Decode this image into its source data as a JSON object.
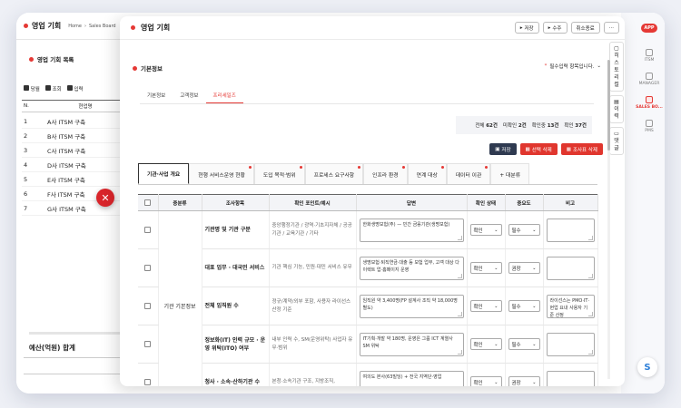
{
  "background_window": {
    "title": "영업 기회",
    "crumbs": [
      "Home",
      "Sales Board"
    ],
    "list_title": "영업 기회 목록",
    "filters": [
      "당월",
      "조회",
      "입력"
    ],
    "columns": [
      "N.",
      "현업명"
    ],
    "rows": [
      {
        "n": "1",
        "name": "A사 ITSM 구축"
      },
      {
        "n": "2",
        "name": "B사 ITSM 구축"
      },
      {
        "n": "3",
        "name": "C사 ITSM 구축"
      },
      {
        "n": "4",
        "name": "D사 ITSM 구축"
      },
      {
        "n": "5",
        "name": "E사 ITSM 구축"
      },
      {
        "n": "6",
        "name": "F사 ITSM 구축"
      },
      {
        "n": "7",
        "name": "G사 ITSM 구축"
      }
    ],
    "total_label": "예산(억원) 합계"
  },
  "rail": {
    "app_badge": "APP",
    "items": [
      {
        "label": "ITSM",
        "active": false
      },
      {
        "label": "MANAGER",
        "active": false
      },
      {
        "label": "SALES BO...",
        "active": true
      },
      {
        "label": "PMS",
        "active": false
      }
    ]
  },
  "window": {
    "title": "영업 기회",
    "buttons": [
      "저장",
      "수주",
      "취소종료",
      "···"
    ],
    "side_tabs": [
      [
        "히",
        "스",
        "토",
        "리",
        "컬"
      ],
      [
        "이",
        "력"
      ],
      [
        "댓",
        "글"
      ]
    ],
    "section_title": "기본정보",
    "required_note": "필수입력 항목입니다.",
    "tabs": [
      {
        "label": "기본정보",
        "active": false
      },
      {
        "label": "고객정보",
        "active": false
      },
      {
        "label": "프리세일즈",
        "active": true
      }
    ],
    "summary": [
      {
        "label": "전체",
        "value": "62건"
      },
      {
        "label": "미확인",
        "value": "2건"
      },
      {
        "label": "확인중",
        "value": "13건"
      },
      {
        "label": "확인",
        "value": "37건"
      }
    ],
    "actions": {
      "save": "저장",
      "delete_selected": "선택 삭제",
      "delete_search": "조사표 삭제"
    },
    "sub_tabs": [
      {
        "label": "기관·사업 개요",
        "active": true
      },
      {
        "label": "현행 서비스운영 현황",
        "active": false
      },
      {
        "label": "도입 목적·범위",
        "active": false
      },
      {
        "label": "프로세스 요구사항",
        "active": false
      },
      {
        "label": "인프라 환경",
        "active": false
      },
      {
        "label": "연계 대상",
        "active": false
      },
      {
        "label": "데이터 이관",
        "active": false
      },
      {
        "label": "+ 대분류",
        "active": false
      }
    ],
    "table": {
      "headers": [
        "",
        "중분류",
        "조사항목",
        "확인 포인트/예시",
        "답변",
        "확인 상태",
        "중요도",
        "비고"
      ],
      "category": "기관 기본정보",
      "rows": [
        {
          "item": "기관명 및 기관 구분",
          "point": "중앙행정기관 / 광역·기초지자체 / 공공기관 / 교육기관 / 기타",
          "answer": "한화생명보험(주) — 민간 금융기관(생명보험)",
          "status": "확인",
          "importance": "필수",
          "note": ""
        },
        {
          "item": "대표 업무 · 대국민 서비스",
          "point": "기관 핵심 기능, 민원·대민 서비스 유무",
          "answer": "생명보험·퇴직연금·대출 등 보험 업무, 고객 대상 다이렉트 업·홈페이지 운영",
          "status": "확인",
          "importance": "권장",
          "note": ""
        },
        {
          "item": "전체 임직원 수",
          "point": "정규/계약/외부 포함, 사용자 라이선스 산정 기준",
          "answer": "임직원 약 3,400명(FP 설계사 조직 약 18,000명 별도)",
          "status": "확인",
          "importance": "필수",
          "note": "라이선스는 PMO·IT·현업 요내 사용자 기준 산정"
        },
        {
          "item": "정보화(IT) 인력 규모 · 운영 위탁(ITO) 여부",
          "point": "내부 인력 수, SM(운영위탁) 사업자 유무·범위",
          "answer": "IT기획·개발 약 180명, 운영은 그룹 ICT 계열사 SM 위탁",
          "status": "확인",
          "importance": "필수",
          "note": ""
        },
        {
          "item": "청사 · 소속·산하기관 수",
          "point": "본청·소속기관 구조, 지방조직,",
          "answer": "여의도 본사(63빌딩) + 전국 지역단·영업",
          "status": "확인",
          "importance": "권장",
          "note": ""
        }
      ]
    }
  }
}
